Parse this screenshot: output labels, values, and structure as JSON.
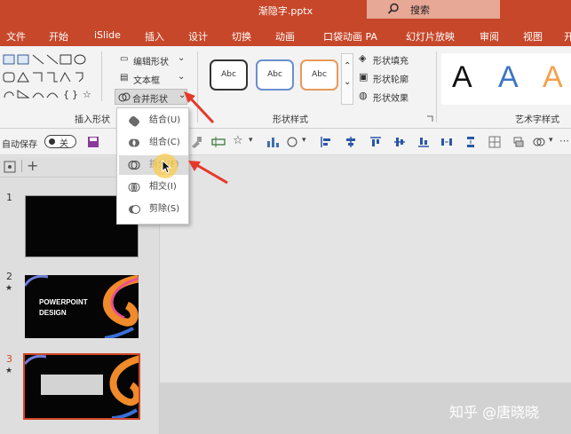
{
  "title": "渐隐字.pptx",
  "search": {
    "label": "搜索"
  },
  "tabs": [
    "文件",
    "开始",
    "iSlide",
    "插入",
    "设计",
    "切换",
    "动画",
    "口袋动画 PA",
    "幻灯片放映",
    "审阅",
    "视图",
    "开"
  ],
  "ribbon": {
    "edit_shape": "编辑形状",
    "textbox": "文本框",
    "merge_shape": "合并形状",
    "group_insert": "插入形状",
    "style_sample": "Abc",
    "group_style": "形状样式",
    "fill": "形状填充",
    "outline": "形状轮廓",
    "effect": "形状效果",
    "art_sample": "A",
    "group_art": "艺术字样式"
  },
  "qat": {
    "autosave": "自动保存",
    "toggle": "关"
  },
  "dropdown": {
    "items": [
      "结合(U)",
      "组合(C)",
      "拆分(F)",
      "相交(I)",
      "剪除(S)"
    ],
    "highlighted": 2
  },
  "slides": [
    {
      "number": "1"
    },
    {
      "number": "2",
      "star": "★",
      "line1": "POWERPOINT",
      "line2": "DESIGN"
    },
    {
      "number": "3",
      "star": "★"
    }
  ],
  "watermark": "知乎 @唐晓晓",
  "colors": {
    "accent": "#c7472a",
    "arrow": "#e43a2a",
    "active_slide": "#d24726"
  }
}
